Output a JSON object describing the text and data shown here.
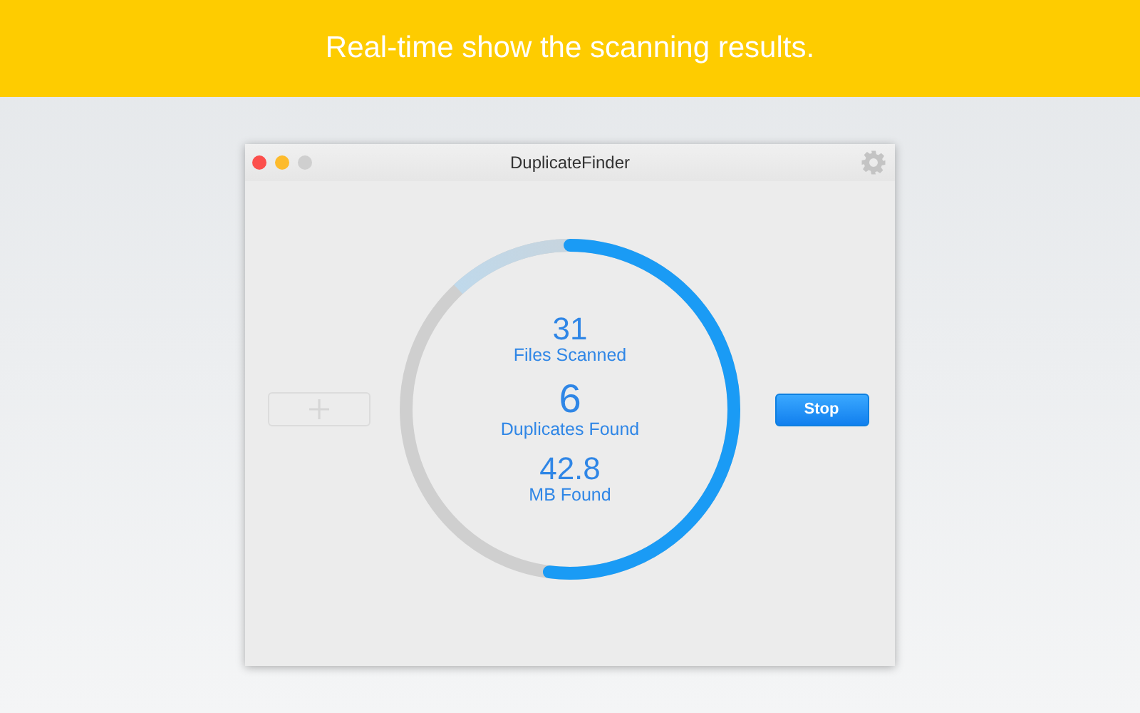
{
  "banner": {
    "title": "Real-time show the scanning results."
  },
  "window": {
    "title": "DuplicateFinder"
  },
  "scan": {
    "level": 0.52,
    "stats": [
      {
        "value": "31",
        "label": "Files Scanned"
      },
      {
        "value": "6",
        "label": "Duplicates Found"
      },
      {
        "value": "42.8",
        "label": "MB Found"
      }
    ]
  },
  "add_button": {
    "disabled": true
  },
  "stop_button": {
    "label": "Stop"
  }
}
